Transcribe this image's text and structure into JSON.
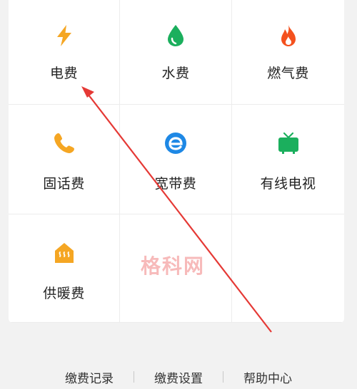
{
  "grid": {
    "items": [
      {
        "label": "电费",
        "icon": "lightning-icon"
      },
      {
        "label": "水费",
        "icon": "water-drop-icon"
      },
      {
        "label": "燃气费",
        "icon": "flame-icon"
      },
      {
        "label": "固话费",
        "icon": "phone-icon"
      },
      {
        "label": "宽带费",
        "icon": "broadband-e-icon"
      },
      {
        "label": "有线电视",
        "icon": "tv-icon"
      },
      {
        "label": "供暖费",
        "icon": "heating-icon"
      }
    ]
  },
  "footer": {
    "links": [
      "缴费记录",
      "缴费设置",
      "帮助中心"
    ]
  },
  "watermark": "格科网",
  "colors": {
    "orange": "#F5A623",
    "green": "#1BAF5D",
    "red_orange": "#F4511E",
    "blue": "#1E88E5",
    "arrow": "#E53935"
  }
}
